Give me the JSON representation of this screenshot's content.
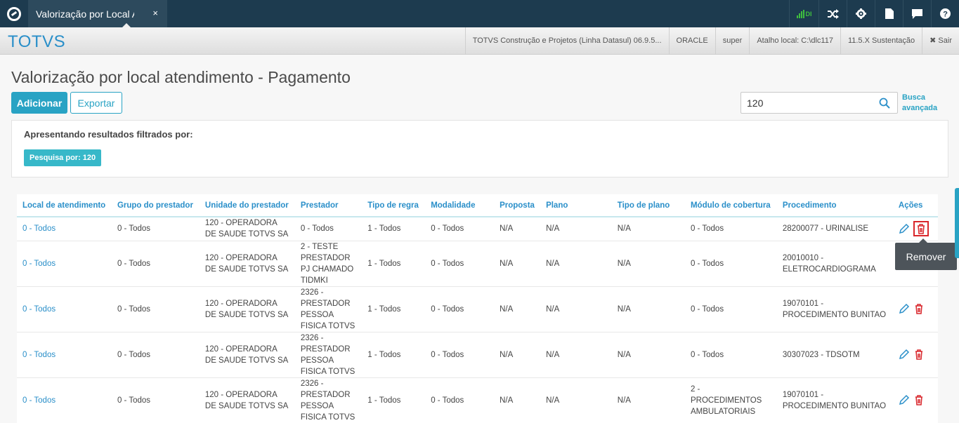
{
  "app": {
    "tab_title": "Valorização por Local Atendimento",
    "tab_close": "×",
    "brand": "TOTVS"
  },
  "top_icons": [
    {
      "name": "signal-icon",
      "label": "DI"
    },
    {
      "name": "shuffle-icon",
      "label": "⇄"
    },
    {
      "name": "gear-icon",
      "label": "⚙"
    },
    {
      "name": "document-icon",
      "label": "▮"
    },
    {
      "name": "chat-icon",
      "label": "▬"
    },
    {
      "name": "help-icon",
      "label": "?"
    }
  ],
  "info_bar": {
    "product": "TOTVS Construção e Projetos (Linha Datasul) 06.9.5...",
    "database": "ORACLE",
    "user": "super",
    "shortcut": "Atalho local: C:\\dlc117",
    "version": "11.5.X Sustentação",
    "logout": "✖ Sair"
  },
  "page": {
    "title": "Valorização por local atendimento - Pagamento",
    "add_button": "Adicionar",
    "export_button": "Exportar",
    "search_value": "120",
    "advanced_search_line1": "Busca",
    "advanced_search_line2": "avançada"
  },
  "filter": {
    "label": "Apresentando resultados filtrados por:",
    "chip": "Pesquisa por: 120"
  },
  "table": {
    "headers": [
      "Local de atendimento",
      "Grupo do prestador",
      "Unidade do prestador",
      "Prestador",
      "Tipo de regra",
      "Modalidade",
      "Proposta",
      "Plano",
      "Tipo de plano",
      "Módulo de cobertura",
      "Procedimento",
      "Ações"
    ],
    "rows": [
      [
        "0 - Todos",
        "0 - Todos",
        "120 - OPERADORA DE SAUDE TOTVS SA",
        "0 - Todos",
        "1 - Todos",
        "0 - Todos",
        "N/A",
        "N/A",
        "N/A",
        "0 - Todos",
        "28200077 - URINALISE"
      ],
      [
        "0 - Todos",
        "0 - Todos",
        "120 - OPERADORA DE SAUDE TOTVS SA",
        "2 - TESTE PRESTADOR PJ CHAMADO TIDMKI",
        "1 - Todos",
        "0 - Todos",
        "N/A",
        "N/A",
        "N/A",
        "0 - Todos",
        "20010010 - ELETROCARDIOGRAMA"
      ],
      [
        "0 - Todos",
        "0 - Todos",
        "120 - OPERADORA DE SAUDE TOTVS SA",
        "2326 - PRESTADOR PESSOA FISICA TOTVS",
        "1 - Todos",
        "0 - Todos",
        "N/A",
        "N/A",
        "N/A",
        "0 - Todos",
        "19070101 - PROCEDIMENTO BUNITAO"
      ],
      [
        "0 - Todos",
        "0 - Todos",
        "120 - OPERADORA DE SAUDE TOTVS SA",
        "2326 - PRESTADOR PESSOA FISICA TOTVS",
        "1 - Todos",
        "0 - Todos",
        "N/A",
        "N/A",
        "N/A",
        "0 - Todos",
        "30307023 - TDSOTM"
      ],
      [
        "0 - Todos",
        "0 - Todos",
        "120 - OPERADORA DE SAUDE TOTVS SA",
        "2326 - PRESTADOR PESSOA FISICA TOTVS",
        "1 - Todos",
        "0 - Todos",
        "N/A",
        "N/A",
        "N/A",
        "2 - PROCEDIMENTOS AMBULATORIAIS",
        "19070101 - PROCEDIMENTO BUNITAO"
      ]
    ]
  },
  "tooltip": "Remover",
  "colors": {
    "topbar": "#1d3b4f",
    "accent": "#29a3c4",
    "link": "#2a8fc9",
    "delete": "#d9262b"
  }
}
